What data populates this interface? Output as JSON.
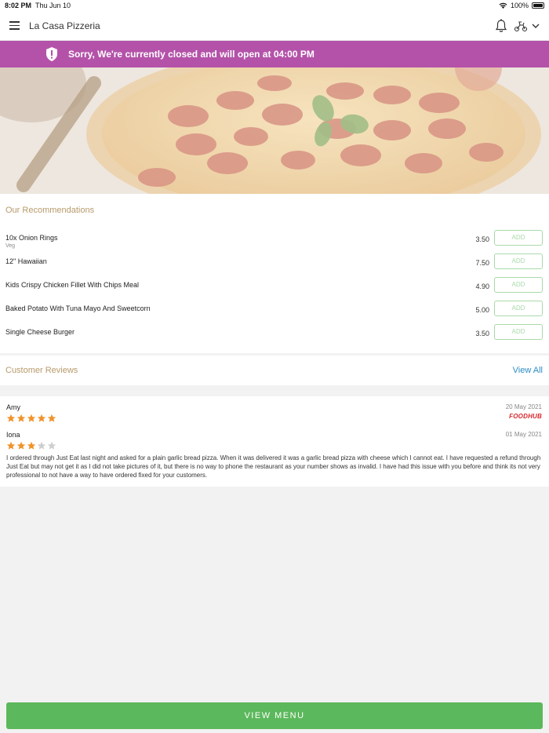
{
  "status_bar": {
    "time": "8:02 PM",
    "date": "Thu Jun 10",
    "battery": "100%"
  },
  "header": {
    "title": "La Casa Pizzeria",
    "icons": [
      "menu-icon",
      "bell-icon",
      "scooter-icon",
      "chevron-down-icon"
    ]
  },
  "banner": {
    "message": "Sorry, We're currently closed and will open at 04:00 PM",
    "color": "#b452a9",
    "icon": "shield-alert-icon"
  },
  "hero": {
    "image": "pepperoni-pizza"
  },
  "recommendations": {
    "title": "Our Recommendations",
    "add_label": "ADD",
    "items": [
      {
        "name": "10x Onion Rings",
        "sub": "Veg",
        "price": "3.50"
      },
      {
        "name": "12\" Hawaiian",
        "sub": "",
        "price": "7.50"
      },
      {
        "name": "Kids Crispy Chicken Fillet With Chips Meal",
        "sub": "",
        "price": "4.90"
      },
      {
        "name": "Baked Potato With Tuna Mayo And Sweetcorn",
        "sub": "",
        "price": "5.00"
      },
      {
        "name": "Single Cheese Burger",
        "sub": "",
        "price": "3.50"
      }
    ]
  },
  "reviews": {
    "title": "Customer Reviews",
    "view_all": "View All",
    "items": [
      {
        "name": "Amy",
        "date": "20 May 2021",
        "rating": 5,
        "source": "FOODHUB",
        "text": ""
      },
      {
        "name": "Iona",
        "date": "01 May 2021",
        "rating": 3,
        "source": "",
        "text": "I ordered through Just Eat last night and asked for a plain garlic bread pizza. When it was delivered it was a garlic bread pizza with cheese which I cannot eat. I have requested a refund through Just Eat but may not get it as I did not take pictures of it, but there is no way to phone the restaurant as your number shows as invalid. I have had this issue with you before and think its not very professional to not have a way to have ordered fixed for your customers."
      }
    ]
  },
  "footer": {
    "view_menu": "VIEW MENU",
    "color": "#5cb85c"
  },
  "colors": {
    "accent_gold": "#b79a6a",
    "link_blue": "#2b8cc4",
    "star_orange": "#f0932b"
  }
}
